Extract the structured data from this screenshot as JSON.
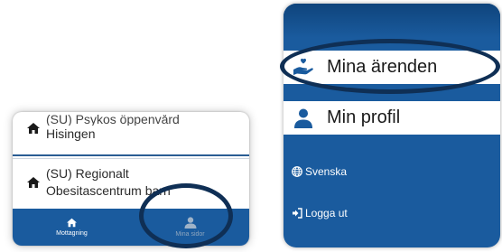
{
  "left_panel": {
    "locations": [
      {
        "name_line1": "(SU) Psykos öppenvård",
        "name_line2": "Hisingen",
        "icon": "home-icon"
      },
      {
        "name_line1": "(SU) Regionalt",
        "name_line2": "Obesitascentrum barn",
        "icon": "home-icon"
      }
    ],
    "bottom_nav": [
      {
        "label": "Mottagning",
        "icon": "home-icon",
        "active": true
      },
      {
        "label": "Mina sidor",
        "icon": "user-icon",
        "active": false
      }
    ]
  },
  "right_panel": {
    "menu": {
      "cases": {
        "label": "Mina ärenden",
        "icon": "hand-heart-icon"
      },
      "profile": {
        "label": "Min profil",
        "icon": "user-icon"
      },
      "language": {
        "label": "Svenska",
        "icon": "globe-icon"
      },
      "logout": {
        "label": "Logga ut",
        "icon": "sign-out-icon"
      }
    }
  },
  "colors": {
    "brand_blue": "#1a5b9e",
    "highlight_ring": "#0f2f55",
    "inactive_tab": "#9fb3c8"
  }
}
